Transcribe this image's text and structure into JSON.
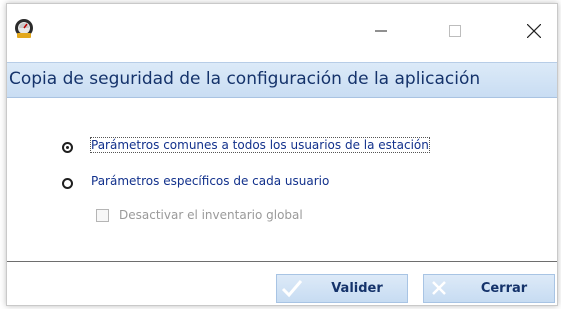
{
  "header": {
    "title": "Copia de seguridad de la configuración de la aplicación"
  },
  "options": {
    "common_label": "Parámetros comunes a todos los usuarios de la estación",
    "specific_label": "Parámetros específicos de cada usuario",
    "selected": "common"
  },
  "checkbox": {
    "label": "Desactivar el inventario global",
    "checked": false,
    "enabled": false
  },
  "buttons": {
    "validate_label": "Valider",
    "close_label": "Cerrar"
  },
  "colors": {
    "accent": "#15336b",
    "header_bg": "#cfe1f5",
    "button_bg": "#cfe1f5"
  },
  "icons": {
    "app": "app-gauge-icon",
    "minimize": "minimize-icon",
    "maximize": "maximize-icon",
    "close": "close-icon",
    "validate": "checkmark-icon",
    "cancel": "x-icon"
  }
}
